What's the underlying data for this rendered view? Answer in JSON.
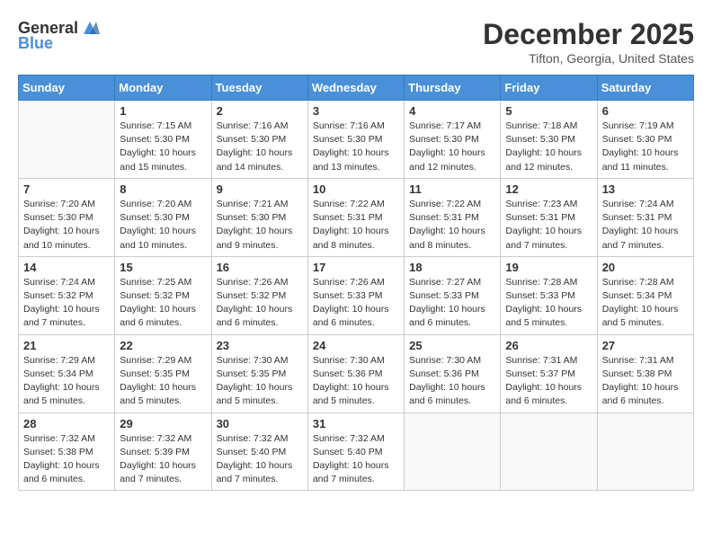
{
  "logo": {
    "general": "General",
    "blue": "Blue"
  },
  "title": "December 2025",
  "location": "Tifton, Georgia, United States",
  "weekdays": [
    "Sunday",
    "Monday",
    "Tuesday",
    "Wednesday",
    "Thursday",
    "Friday",
    "Saturday"
  ],
  "weeks": [
    [
      {
        "day": "",
        "info": ""
      },
      {
        "day": "1",
        "info": "Sunrise: 7:15 AM\nSunset: 5:30 PM\nDaylight: 10 hours\nand 15 minutes."
      },
      {
        "day": "2",
        "info": "Sunrise: 7:16 AM\nSunset: 5:30 PM\nDaylight: 10 hours\nand 14 minutes."
      },
      {
        "day": "3",
        "info": "Sunrise: 7:16 AM\nSunset: 5:30 PM\nDaylight: 10 hours\nand 13 minutes."
      },
      {
        "day": "4",
        "info": "Sunrise: 7:17 AM\nSunset: 5:30 PM\nDaylight: 10 hours\nand 12 minutes."
      },
      {
        "day": "5",
        "info": "Sunrise: 7:18 AM\nSunset: 5:30 PM\nDaylight: 10 hours\nand 12 minutes."
      },
      {
        "day": "6",
        "info": "Sunrise: 7:19 AM\nSunset: 5:30 PM\nDaylight: 10 hours\nand 11 minutes."
      }
    ],
    [
      {
        "day": "7",
        "info": "Sunrise: 7:20 AM\nSunset: 5:30 PM\nDaylight: 10 hours\nand 10 minutes."
      },
      {
        "day": "8",
        "info": "Sunrise: 7:20 AM\nSunset: 5:30 PM\nDaylight: 10 hours\nand 10 minutes."
      },
      {
        "day": "9",
        "info": "Sunrise: 7:21 AM\nSunset: 5:30 PM\nDaylight: 10 hours\nand 9 minutes."
      },
      {
        "day": "10",
        "info": "Sunrise: 7:22 AM\nSunset: 5:31 PM\nDaylight: 10 hours\nand 8 minutes."
      },
      {
        "day": "11",
        "info": "Sunrise: 7:22 AM\nSunset: 5:31 PM\nDaylight: 10 hours\nand 8 minutes."
      },
      {
        "day": "12",
        "info": "Sunrise: 7:23 AM\nSunset: 5:31 PM\nDaylight: 10 hours\nand 7 minutes."
      },
      {
        "day": "13",
        "info": "Sunrise: 7:24 AM\nSunset: 5:31 PM\nDaylight: 10 hours\nand 7 minutes."
      }
    ],
    [
      {
        "day": "14",
        "info": "Sunrise: 7:24 AM\nSunset: 5:32 PM\nDaylight: 10 hours\nand 7 minutes."
      },
      {
        "day": "15",
        "info": "Sunrise: 7:25 AM\nSunset: 5:32 PM\nDaylight: 10 hours\nand 6 minutes."
      },
      {
        "day": "16",
        "info": "Sunrise: 7:26 AM\nSunset: 5:32 PM\nDaylight: 10 hours\nand 6 minutes."
      },
      {
        "day": "17",
        "info": "Sunrise: 7:26 AM\nSunset: 5:33 PM\nDaylight: 10 hours\nand 6 minutes."
      },
      {
        "day": "18",
        "info": "Sunrise: 7:27 AM\nSunset: 5:33 PM\nDaylight: 10 hours\nand 6 minutes."
      },
      {
        "day": "19",
        "info": "Sunrise: 7:28 AM\nSunset: 5:33 PM\nDaylight: 10 hours\nand 5 minutes."
      },
      {
        "day": "20",
        "info": "Sunrise: 7:28 AM\nSunset: 5:34 PM\nDaylight: 10 hours\nand 5 minutes."
      }
    ],
    [
      {
        "day": "21",
        "info": "Sunrise: 7:29 AM\nSunset: 5:34 PM\nDaylight: 10 hours\nand 5 minutes."
      },
      {
        "day": "22",
        "info": "Sunrise: 7:29 AM\nSunset: 5:35 PM\nDaylight: 10 hours\nand 5 minutes."
      },
      {
        "day": "23",
        "info": "Sunrise: 7:30 AM\nSunset: 5:35 PM\nDaylight: 10 hours\nand 5 minutes."
      },
      {
        "day": "24",
        "info": "Sunrise: 7:30 AM\nSunset: 5:36 PM\nDaylight: 10 hours\nand 5 minutes."
      },
      {
        "day": "25",
        "info": "Sunrise: 7:30 AM\nSunset: 5:36 PM\nDaylight: 10 hours\nand 6 minutes."
      },
      {
        "day": "26",
        "info": "Sunrise: 7:31 AM\nSunset: 5:37 PM\nDaylight: 10 hours\nand 6 minutes."
      },
      {
        "day": "27",
        "info": "Sunrise: 7:31 AM\nSunset: 5:38 PM\nDaylight: 10 hours\nand 6 minutes."
      }
    ],
    [
      {
        "day": "28",
        "info": "Sunrise: 7:32 AM\nSunset: 5:38 PM\nDaylight: 10 hours\nand 6 minutes."
      },
      {
        "day": "29",
        "info": "Sunrise: 7:32 AM\nSunset: 5:39 PM\nDaylight: 10 hours\nand 7 minutes."
      },
      {
        "day": "30",
        "info": "Sunrise: 7:32 AM\nSunset: 5:40 PM\nDaylight: 10 hours\nand 7 minutes."
      },
      {
        "day": "31",
        "info": "Sunrise: 7:32 AM\nSunset: 5:40 PM\nDaylight: 10 hours\nand 7 minutes."
      },
      {
        "day": "",
        "info": ""
      },
      {
        "day": "",
        "info": ""
      },
      {
        "day": "",
        "info": ""
      }
    ]
  ]
}
